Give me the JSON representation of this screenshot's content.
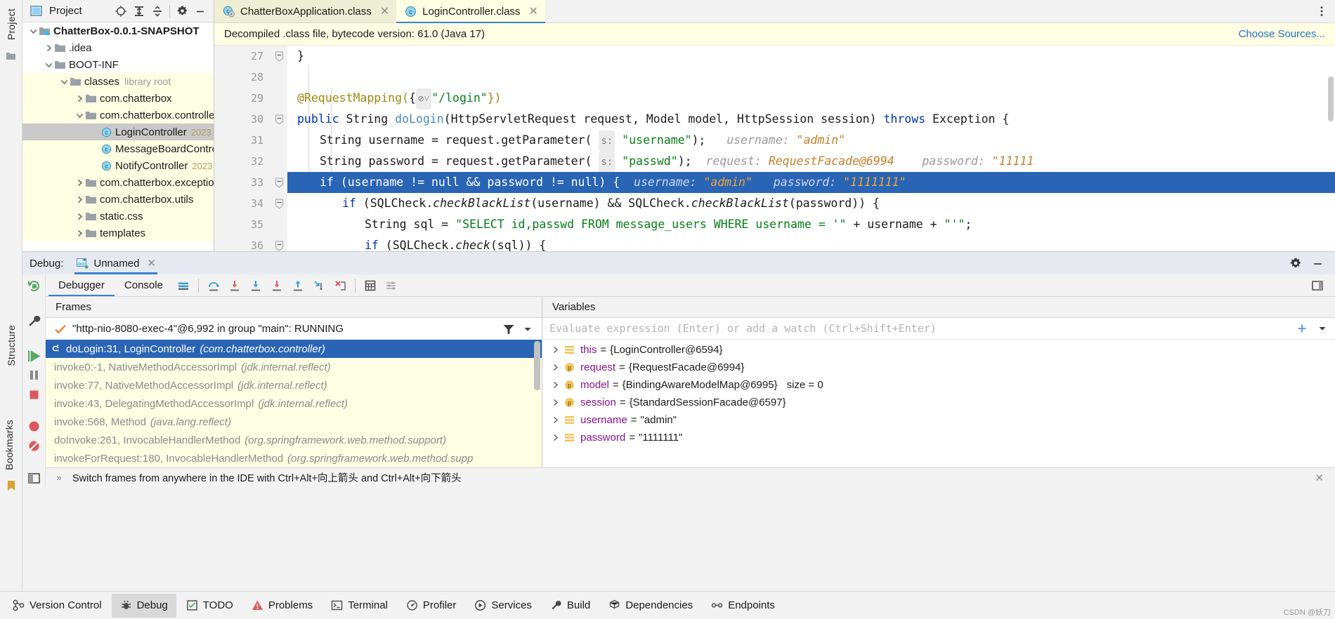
{
  "rails": {
    "left": [
      {
        "label": "Project",
        "icon": "project-icon"
      },
      {
        "label": "Structure",
        "icon": "structure-icon"
      },
      {
        "label": "Bookmarks",
        "icon": "bookmarks-icon"
      }
    ]
  },
  "project_panel": {
    "title": "Project",
    "buttons": [
      {
        "name": "locate-icon",
        "tip": "Select Opened File"
      },
      {
        "name": "expand-all-icon",
        "tip": "Expand All"
      },
      {
        "name": "collapse-all-icon",
        "tip": "Collapse All"
      },
      {
        "name": "gear-icon",
        "tip": "Options"
      },
      {
        "name": "minimize-icon",
        "tip": "Hide"
      }
    ],
    "tree": [
      {
        "label": "ChatterBox-0.0.1-SNAPSHOT",
        "indent": 0,
        "twisty": "down",
        "icon": "module-folder-icon",
        "bold": true,
        "lib": false,
        "selected": false
      },
      {
        "label": ".idea",
        "indent": 1,
        "twisty": "right",
        "icon": "folder-icon",
        "bold": false,
        "lib": false,
        "selected": false
      },
      {
        "label": "BOOT-INF",
        "indent": 1,
        "twisty": "down",
        "icon": "folder-icon",
        "bold": false,
        "lib": false,
        "selected": false
      },
      {
        "label": "classes",
        "sub": "library root",
        "indent": 2,
        "twisty": "down",
        "icon": "folder-icon",
        "bold": false,
        "lib": true,
        "selected": false
      },
      {
        "label": "com.chatterbox",
        "indent": 3,
        "twisty": "right",
        "icon": "package-icon",
        "bold": false,
        "lib": true,
        "selected": false
      },
      {
        "label": "com.chatterbox.controller",
        "indent": 3,
        "twisty": "down",
        "icon": "package-icon",
        "bold": false,
        "lib": true,
        "selected": false
      },
      {
        "label": "LoginController",
        "ver": "2023",
        "indent": 4,
        "twisty": "none",
        "icon": "class-icon",
        "bold": false,
        "lib": true,
        "selected": true
      },
      {
        "label": "MessageBoardController",
        "indent": 4,
        "twisty": "none",
        "icon": "class-icon",
        "bold": false,
        "lib": true,
        "selected": false
      },
      {
        "label": "NotifyController",
        "ver": "2023",
        "indent": 4,
        "twisty": "none",
        "icon": "class-icon",
        "bold": false,
        "lib": true,
        "selected": false
      },
      {
        "label": "com.chatterbox.exception",
        "indent": 3,
        "twisty": "right",
        "icon": "package-icon",
        "bold": false,
        "lib": true,
        "selected": false
      },
      {
        "label": "com.chatterbox.utils",
        "indent": 3,
        "twisty": "right",
        "icon": "package-icon",
        "bold": false,
        "lib": true,
        "selected": false
      },
      {
        "label": "static.css",
        "indent": 3,
        "twisty": "right",
        "icon": "folder-icon",
        "bold": false,
        "lib": true,
        "selected": false
      },
      {
        "label": "templates",
        "indent": 3,
        "twisty": "right",
        "icon": "folder-icon",
        "bold": false,
        "lib": true,
        "selected": false
      }
    ]
  },
  "editor": {
    "tabs": [
      {
        "label": "ChatterBoxApplication.class",
        "icon": "class-run-icon",
        "active": false,
        "closable": true
      },
      {
        "label": "LoginController.class",
        "icon": "class-icon",
        "active": true,
        "closable": true
      }
    ],
    "more_button": "more-options-icon",
    "notice": {
      "text": "Decompiled .class file, bytecode version: 61.0 (Java 17)",
      "action": "Choose Sources..."
    },
    "lines": [
      {
        "num": "27",
        "fold": "minus"
      },
      {
        "num": "28",
        "fold": "none"
      },
      {
        "num": "29",
        "fold": "none"
      },
      {
        "num": "30",
        "fold": "minus"
      },
      {
        "num": "31",
        "fold": "none"
      },
      {
        "num": "32",
        "fold": "none"
      },
      {
        "num": "33",
        "fold": "minus",
        "breakpoint": true,
        "current": true
      },
      {
        "num": "34",
        "fold": "minus"
      },
      {
        "num": "35",
        "fold": "none"
      },
      {
        "num": "36",
        "fold": "minus"
      }
    ],
    "code": {
      "l27": "}",
      "l29_ann": "@RequestMapping(",
      "l29_brace": "{",
      "l29_path": "\"/login\"",
      "l29_end": "})",
      "l30_kw": "public",
      "l30_type": " String ",
      "l30_method": "doLogin",
      "l30_params": "(HttpServletRequest request, Model model, HttpSession session) ",
      "l30_throws": "throws",
      "l30_tail": " Exception {",
      "l31_pre": "String username = request.getParameter(",
      "l31_pbadge": "s:",
      "l31_str": "\"username\"",
      "l31_post": ");",
      "l31_hint_name": "username:",
      "l31_hint_val": "\"admin\"",
      "l32_pre": "String password = request.getParameter(",
      "l32_pbadge": "s:",
      "l32_str": "\"passwd\"",
      "l32_post": ");",
      "l32_hint_name": "request:",
      "l32_hint_val": "RequestFacade@6994",
      "l32_hint_name2": "password:",
      "l32_hint_val2": "\"11111",
      "l33_code": "if (username != null && password != null) {",
      "l33_hint_name": "username:",
      "l33_hint_val": "\"admin\"",
      "l33_hint_name2": "password:",
      "l33_hint_val2": "\"1111111\"",
      "l34_pre": "if (SQLCheck.",
      "l34_m": "checkBlackList",
      "l34_mid": "(username) && SQLCheck.",
      "l34_m2": "checkBlackList",
      "l34_post": "(password)) {",
      "l35_pre": "String sql = ",
      "l35_str": "\"SELECT id,passwd FROM message_users WHERE username = '\"",
      "l35_mid": " + username + ",
      "l35_str2": "\"'\"",
      "l35_end": ";",
      "l36_pre": "if (SQLCheck.",
      "l36_m": "check",
      "l36_post": "(sql)) {"
    }
  },
  "debug": {
    "header_label": "Debug:",
    "session_name": "Unnamed",
    "session_icon": "debug-config-icon",
    "close_icon": "close-icon",
    "header_buttons": [
      {
        "name": "gear-icon"
      },
      {
        "name": "minimize-icon"
      }
    ],
    "sidebar_buttons": [
      {
        "name": "rerun-icon",
        "color": "#59a869"
      },
      {
        "name": "settings-wrench-icon",
        "color": "#5a5a5a"
      },
      {
        "name": "resume-icon",
        "color": "#59a869"
      },
      {
        "name": "pause-icon",
        "color": "#7a7a7a"
      },
      {
        "name": "stop-icon",
        "color": "#db5860"
      },
      {
        "name": "mute-breakpoints-icon",
        "color": "#db5860"
      },
      {
        "name": "view-breakpoints-icon",
        "color": "#db5860"
      },
      {
        "name": "layout-icon",
        "color": "#5a5a5a"
      }
    ],
    "tabs": [
      {
        "label": "Debugger",
        "active": true
      },
      {
        "label": "Console",
        "active": false
      }
    ],
    "toolbar_buttons": [
      {
        "name": "show-execution-point-icon"
      },
      {
        "name": "step-over-icon"
      },
      {
        "name": "step-into-icon"
      },
      {
        "name": "force-step-into-icon"
      },
      {
        "name": "step-out-icon"
      },
      {
        "name": "drop-frame-icon"
      },
      {
        "name": "run-to-cursor-icon"
      },
      {
        "name": "reset-frame-icon"
      },
      {
        "name": "evaluate-expression-icon"
      },
      {
        "name": "settings-list-icon"
      },
      {
        "name": "restore-layout-icon"
      }
    ],
    "frames": {
      "title": "Frames",
      "thread": "\"http-nio-8080-exec-4\"@6,992 in group \"main\": RUNNING",
      "thread_icon": "check-icon",
      "filter_icon": "filter-icon",
      "dropdown_icon": "chevron-down-icon",
      "items": [
        {
          "main": "doLogin:31, LoginController",
          "pkg": "(com.chatterbox.controller)",
          "selected": true
        },
        {
          "main": "invoke0:-1, NativeMethodAccessorImpl",
          "pkg": "(jdk.internal.reflect)",
          "selected": false
        },
        {
          "main": "invoke:77, NativeMethodAccessorImpl",
          "pkg": "(jdk.internal.reflect)",
          "selected": false
        },
        {
          "main": "invoke:43, DelegatingMethodAccessorImpl",
          "pkg": "(jdk.internal.reflect)",
          "selected": false
        },
        {
          "main": "invoke:568, Method",
          "pkg": "(java.lang.reflect)",
          "selected": false
        },
        {
          "main": "doInvoke:261, InvocableHandlerMethod",
          "pkg": "(org.springframework.web.method.support)",
          "selected": false
        },
        {
          "main": "invokeForRequest:180, InvocableHandlerMethod",
          "pkg": "(org.springframework.web.method.supp",
          "selected": false
        }
      ]
    },
    "variables": {
      "title": "Variables",
      "evaluate_placeholder": "Evaluate expression (Enter) or add a watch (Ctrl+Shift+Enter)",
      "add_watch_icon": "add-icon",
      "watch_dropdown_icon": "chevron-down-icon",
      "items": [
        {
          "expandable": true,
          "badge": "field",
          "name": "this",
          "value": "{LoginController@6594}"
        },
        {
          "expandable": true,
          "badge": "param",
          "name": "request",
          "value": "{RequestFacade@6994}"
        },
        {
          "expandable": true,
          "badge": "param",
          "name": "model",
          "value": "{BindingAwareModelMap@6995}",
          "size": "size = 0"
        },
        {
          "expandable": true,
          "badge": "param",
          "name": "session",
          "value": "{StandardSessionFacade@6597}"
        },
        {
          "expandable": true,
          "badge": "field",
          "name": "username",
          "value": "\"admin\""
        },
        {
          "expandable": true,
          "badge": "field",
          "name": "password",
          "value": "\"1111111\""
        }
      ]
    },
    "hintbar": {
      "text": "Switch frames from anywhere in the IDE with Ctrl+Alt+向上箭头 and Ctrl+Alt+向下箭头",
      "expand_icon": "chevron-right-icon",
      "close_icon": "close-icon"
    }
  },
  "statusbar": {
    "items": [
      {
        "label": "Version Control",
        "icon": "version-control-icon",
        "active": false
      },
      {
        "label": "Debug",
        "icon": "debug-icon",
        "active": true
      },
      {
        "label": "TODO",
        "icon": "todo-icon",
        "active": false
      },
      {
        "label": "Problems",
        "icon": "problems-icon",
        "active": false
      },
      {
        "label": "Terminal",
        "icon": "terminal-icon",
        "active": false
      },
      {
        "label": "Profiler",
        "icon": "profiler-icon",
        "active": false
      },
      {
        "label": "Services",
        "icon": "services-icon",
        "active": false
      },
      {
        "label": "Build",
        "icon": "build-icon",
        "active": false
      },
      {
        "label": "Dependencies",
        "icon": "dependencies-icon",
        "active": false
      },
      {
        "label": "Endpoints",
        "icon": "endpoints-icon",
        "active": false
      }
    ],
    "watermark": "CSDN @妖刀"
  },
  "colors": {
    "accent": "#2a64b4",
    "library_bg": "#ffffe4",
    "link": "#2470c4",
    "keyword": "#0033b3",
    "string": "#067d17",
    "annotation": "#9e880d",
    "hint_value": "#c77d29"
  }
}
